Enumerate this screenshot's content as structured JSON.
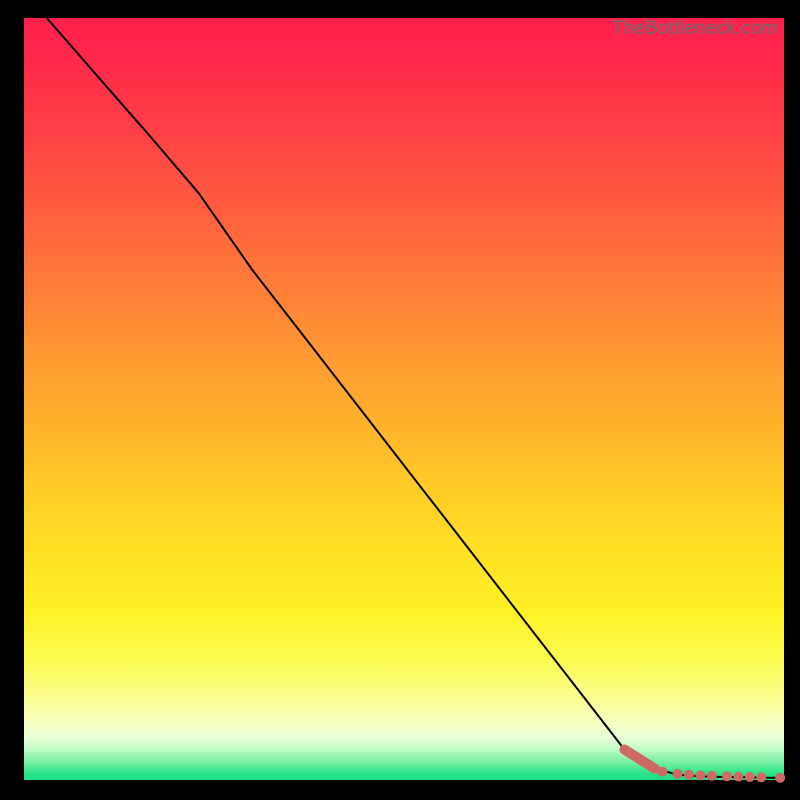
{
  "watermark": "TheBottleneck.com",
  "colors": {
    "frame": "#000000",
    "curve": "#000000",
    "marker": "#cf6a63"
  },
  "chart_data": {
    "type": "line",
    "title": "",
    "xlabel": "",
    "ylabel": "",
    "xlim": [
      0,
      100
    ],
    "ylim": [
      0,
      100
    ],
    "grid": false,
    "legend": false,
    "background_gradient_stops": [
      {
        "pos": 0,
        "color": "#ff1f4e"
      },
      {
        "pos": 24,
        "color": "#ff5a3f"
      },
      {
        "pos": 54,
        "color": "#ffb42b"
      },
      {
        "pos": 78,
        "color": "#fff126"
      },
      {
        "pos": 92.5,
        "color": "#f7ffc2"
      },
      {
        "pos": 100,
        "color": "#17df82"
      }
    ],
    "series": [
      {
        "name": "curve",
        "style": "line",
        "x": [
          3,
          10,
          17,
          23,
          30,
          37,
          44,
          51,
          58,
          65,
          72,
          79,
          83,
          86,
          89,
          92,
          95,
          98,
          100
        ],
        "y": [
          100,
          92,
          84,
          77,
          67,
          58,
          49,
          40,
          31,
          22,
          13,
          4,
          1.5,
          0.7,
          0.5,
          0.4,
          0.35,
          0.3,
          0.3
        ]
      },
      {
        "name": "highlight-segment",
        "style": "thick-line",
        "x": [
          79,
          83
        ],
        "y": [
          4,
          1.5
        ]
      },
      {
        "name": "highlight-dots",
        "style": "scatter",
        "x": [
          84,
          86,
          87.5,
          89,
          90.5,
          92.5,
          94,
          95.5,
          97,
          99.5
        ],
        "y": [
          1.1,
          0.8,
          0.7,
          0.6,
          0.55,
          0.5,
          0.45,
          0.4,
          0.35,
          0.3
        ]
      }
    ]
  }
}
